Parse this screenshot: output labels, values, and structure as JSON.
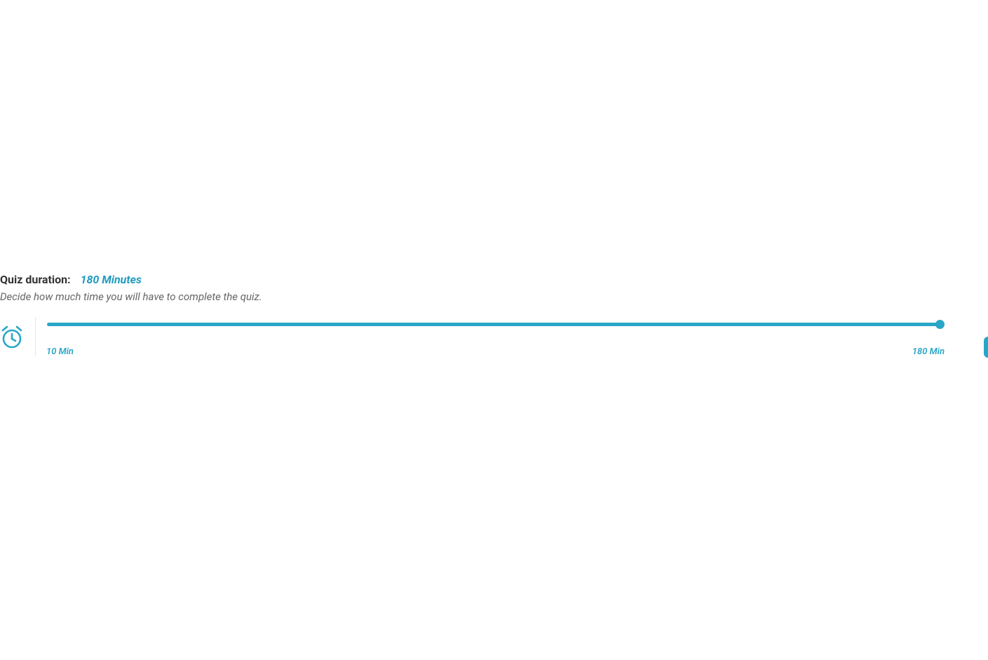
{
  "duration": {
    "label": "Quiz duration:",
    "value_text": "180 Minutes",
    "subtext": "Decide how much time you will have to complete the quiz."
  },
  "slider": {
    "min_label": "10 Min",
    "max_label": "180 Min",
    "min": 10,
    "max": 180,
    "value": 180,
    "accent": "#29a6c7"
  },
  "icons": {
    "clock": "alarm-clock-icon"
  }
}
